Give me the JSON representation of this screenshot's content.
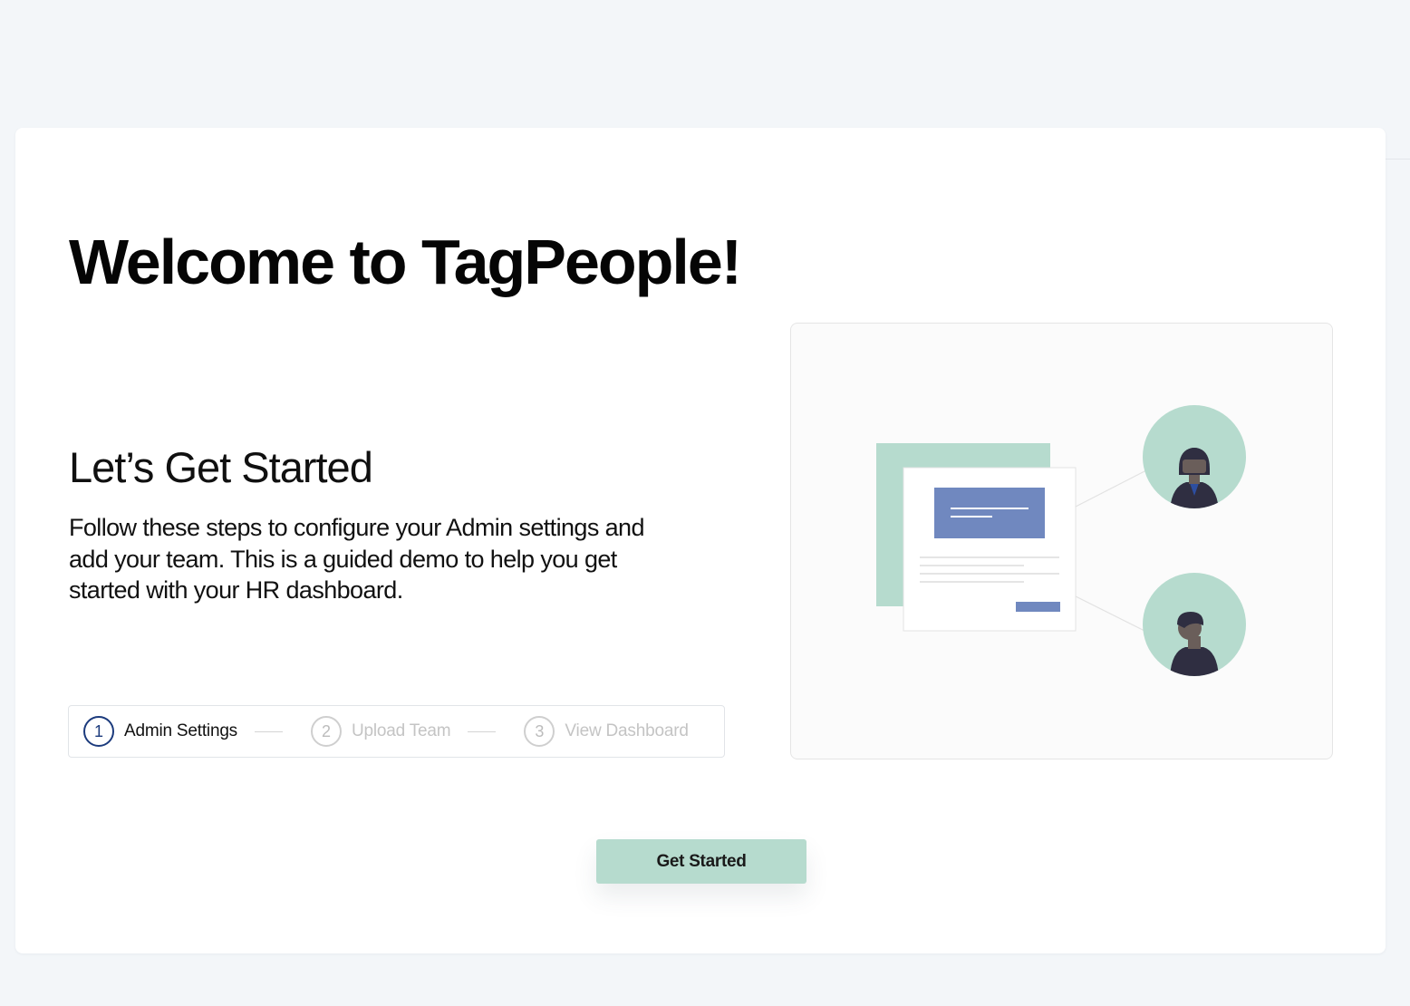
{
  "welcome": {
    "title": "Welcome to TagPeople!",
    "subtitle": "Let’s Get Started",
    "description": "Follow these steps to configure your Admin settings and add your team. This is a guided demo to help you get started with your HR dashboard."
  },
  "steps": [
    {
      "number": "1",
      "label": "Admin Settings",
      "state": "active"
    },
    {
      "number": "2",
      "label": "Upload Team",
      "state": "inactive"
    },
    {
      "number": "3",
      "label": "View Dashboard",
      "state": "inactive"
    }
  ],
  "cta": {
    "label": "Get Started"
  },
  "colors": {
    "page_background": "#f3f6f9",
    "card_background": "#ffffff",
    "accent_green": "#b6dbce",
    "accent_blue": "#7088bf",
    "active_step": "#1c3b7d",
    "inactive_step": "#c4c4c4"
  },
  "icons": {
    "illustration": "team-onboarding-illustration",
    "person_1": "female-avatar-icon",
    "person_2": "male-avatar-icon"
  }
}
